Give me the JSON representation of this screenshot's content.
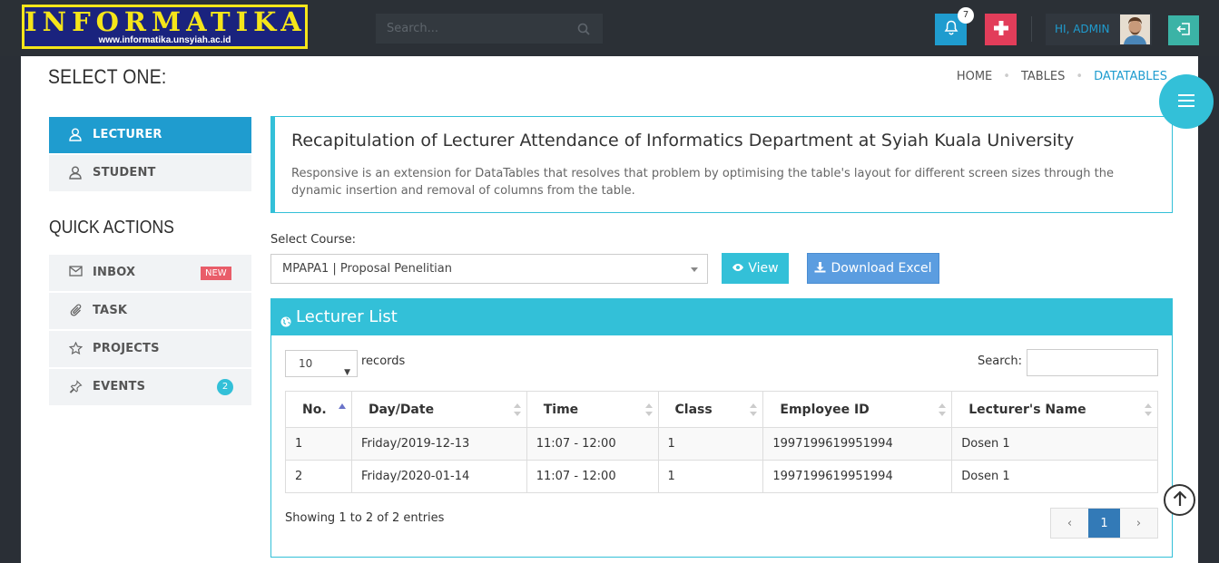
{
  "header": {
    "logo_title": "INFORMATIKA",
    "logo_url": "www.informatika.unsyiah.ac.id",
    "search_placeholder": "Search...",
    "notification_count": "7",
    "user_greeting": "HI, ADMIN"
  },
  "page": {
    "title": "SELECT ONE:",
    "breadcrumb": [
      "HOME",
      "TABLES",
      "DATATABLES"
    ]
  },
  "sidebar": {
    "items": [
      {
        "label": "LECTURER",
        "icon": "user-icon",
        "active": true
      },
      {
        "label": "STUDENT",
        "icon": "user-icon",
        "active": false
      }
    ],
    "quick_actions_title": "QUICK ACTIONS",
    "quick_actions": [
      {
        "label": "INBOX",
        "icon": "envelope-icon",
        "badge": "NEW"
      },
      {
        "label": "TASK",
        "icon": "paperclip-icon"
      },
      {
        "label": "PROJECTS",
        "icon": "star-icon"
      },
      {
        "label": "EVENTS",
        "icon": "pin-icon",
        "badge": "2"
      }
    ]
  },
  "info": {
    "title": "Recapitulation of Lecturer Attendance of Informatics Department at Syiah Kuala University",
    "text": "Responsive is an extension for DataTables that resolves that problem by optimising the table's layout for different screen sizes through the dynamic insertion and removal of columns from the table."
  },
  "course": {
    "label": "Select Course:",
    "selected": "MPAPA1 | Proposal Penelitian",
    "view_label": "View",
    "download_label": "Download Excel"
  },
  "panel": {
    "title": "Lecturer List",
    "length_value": "10",
    "length_label": "records",
    "search_label": "Search:",
    "columns": [
      "No.",
      "Day/Date",
      "Time",
      "Class",
      "Employee ID",
      "Lecturer's Name"
    ],
    "rows": [
      [
        "1",
        "Friday/2019-12-13",
        "11:07 - 12:00",
        "1",
        "1997199619951994",
        "Dosen 1"
      ],
      [
        "2",
        "Friday/2020-01-14",
        "11:07 - 12:00",
        "1",
        "1997199619951994",
        "Dosen 1"
      ]
    ],
    "info": "Showing 1 to 2 of 2 entries",
    "pager": {
      "prev": "‹",
      "current": "1",
      "next": "›"
    }
  },
  "colors": {
    "accent": "#33c0d8",
    "primary": "#1f9ccf",
    "danger": "#e23d5a",
    "topbar": "#2b3036"
  }
}
